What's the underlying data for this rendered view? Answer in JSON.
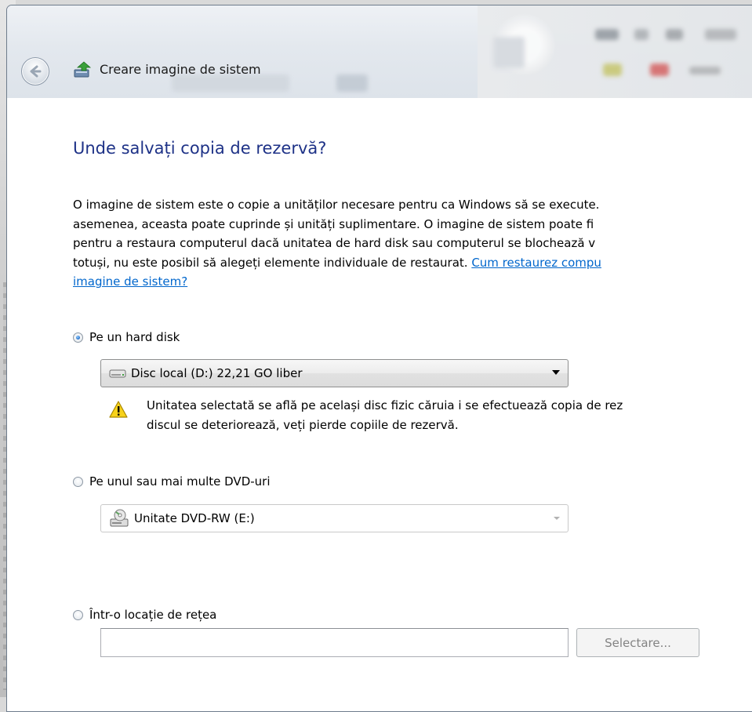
{
  "window": {
    "title": "Creare imagine de sistem"
  },
  "page": {
    "heading": "Unde salvați copia de rezervă?",
    "description_lines": [
      "O imagine de sistem este o copie a unităților necesare pentru ca Windows să se execute.",
      "asemenea, aceasta poate cuprinde și unități suplimentare. O imagine de sistem poate fi",
      "pentru a restaura computerul dacă unitatea de hard disk sau computerul se blochează v",
      "totuși, nu este posibil să alegeți elemente individuale de restaurat. "
    ],
    "link_part1": "Cum restaurez compu",
    "link_part2": "imagine de sistem?"
  },
  "options": {
    "hard_disk": {
      "label": "Pe un hard disk",
      "checked": true,
      "drive_value": "Disc local (D:)  22,21 GO liber",
      "warning_line1": "Unitatea selectată se află pe același disc fizic căruia i se efectuează copia de rez",
      "warning_line2": "discul se deteriorează, veți pierde copiile de rezervă."
    },
    "dvd": {
      "label": "Pe unul sau mai multe DVD-uri",
      "checked": false,
      "drive_value": "Unitate DVD-RW (E:)"
    },
    "network": {
      "label": "Într-o locație de rețea",
      "checked": false,
      "location_value": "",
      "select_button": "Selectare..."
    }
  },
  "icons": {
    "back": "back-arrow-icon",
    "app": "backup-icon",
    "hdd": "hard-disk-icon",
    "dvd": "dvd-drive-icon",
    "warning": "warning-icon"
  },
  "colors": {
    "heading": "#1e3287",
    "link": "#0066cc"
  }
}
